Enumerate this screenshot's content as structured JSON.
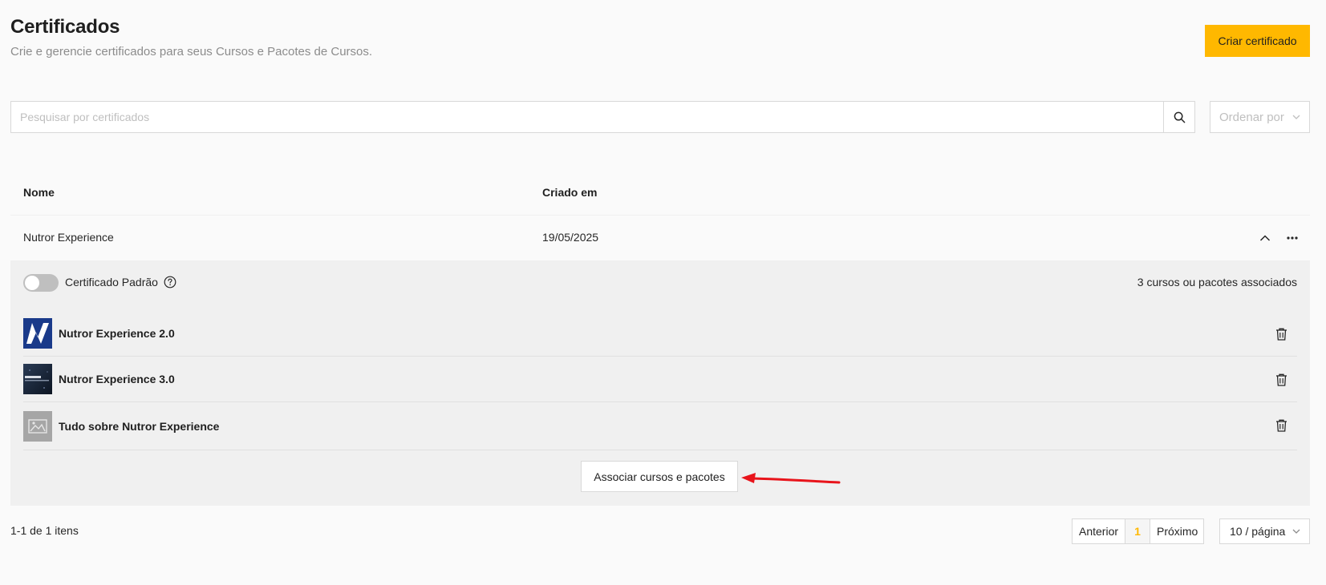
{
  "header": {
    "title": "Certificados",
    "subtitle": "Crie e gerencie certificados para seus Cursos e Pacotes de Cursos.",
    "create_label": "Criar certificado"
  },
  "search": {
    "placeholder": "Pesquisar por certificados",
    "value": "",
    "icon": "search-icon"
  },
  "sort": {
    "placeholder": "Ordenar por",
    "icon": "chevron-down-icon"
  },
  "table": {
    "columns": [
      "Nome",
      "Criado em"
    ],
    "rows": [
      {
        "name": "Nutror Experience",
        "created_at": "19/05/2025",
        "expanded": true,
        "details": {
          "default_label": "Certificado Padrão",
          "default_on": false,
          "assoc_count": "3 cursos ou pacotes associados",
          "courses": [
            {
              "name": "Nutror Experience 2.0",
              "thumb": "nutror-logo-blue"
            },
            {
              "name": "Nutror Experience 3.0",
              "thumb": "nutror-dark-banner"
            },
            {
              "name": "Tudo sobre Nutror Experience",
              "thumb": "image-placeholder-icon"
            }
          ],
          "assoc_button": "Associar cursos e pacotes"
        }
      }
    ]
  },
  "footer": {
    "range": "1-1 de 1 itens",
    "prev": "Anterior",
    "page": "1",
    "next": "Próximo",
    "page_size": "10 / página"
  },
  "colors": {
    "accent": "#ffb800",
    "annotation_arrow": "#e8141b"
  }
}
